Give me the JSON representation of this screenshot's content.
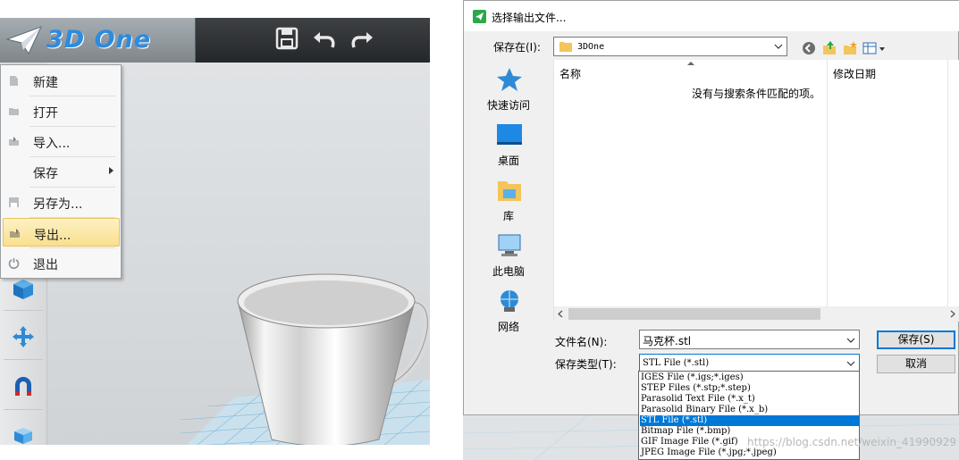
{
  "app": {
    "logo_text": "3D One",
    "toolbar": {
      "save_icon": "save-icon",
      "undo_icon": "undo-icon",
      "redo_icon": "redo-icon"
    },
    "file_menu": {
      "items": [
        {
          "label": "新建",
          "icon": "new-file-icon",
          "has_submenu": false,
          "highlighted": false
        },
        {
          "label": "打开",
          "icon": "open-folder-icon",
          "has_submenu": false,
          "highlighted": false
        },
        {
          "label": "导入...",
          "icon": "import-icon",
          "has_submenu": false,
          "highlighted": false
        },
        {
          "label": "保存",
          "icon": "",
          "has_submenu": true,
          "highlighted": false
        },
        {
          "label": "另存为...",
          "icon": "save-as-icon",
          "has_submenu": false,
          "highlighted": false
        },
        {
          "label": "导出...",
          "icon": "export-icon",
          "has_submenu": false,
          "highlighted": true
        },
        {
          "label": "退出",
          "icon": "power-icon",
          "has_submenu": false,
          "highlighted": false
        }
      ]
    },
    "left_tools": [
      "cube-tool-icon",
      "move-tool-icon",
      "magnet-tool-icon",
      "box-tool-icon"
    ]
  },
  "dialog": {
    "title": "选择输出文件...",
    "save_in_label": "保存在(I):",
    "save_in_value": "3DOne",
    "places": [
      {
        "label": "快速访问",
        "icon": "quick-access-icon"
      },
      {
        "label": "桌面",
        "icon": "desktop-icon"
      },
      {
        "label": "库",
        "icon": "library-icon"
      },
      {
        "label": "此电脑",
        "icon": "this-pc-icon"
      },
      {
        "label": "网络",
        "icon": "network-icon"
      }
    ],
    "columns": [
      "名称",
      "修改日期"
    ],
    "empty_message": "没有与搜索条件匹配的项。",
    "filename_label": "文件名(N):",
    "filename_value": "马克杯.stl",
    "filetype_label": "保存类型(T):",
    "filetype_value": "STL File (*.stl)",
    "save_button": "保存(S)",
    "cancel_button": "取消",
    "filetype_options": [
      "IGES File (*.igs;*.iges)",
      "STEP Files (*.stp;*.step)",
      "Parasolid Text File (*.x_t)",
      "Parasolid Binary File (*.x_b)",
      "STL File (*.stl)",
      "Bitmap File (*.bmp)",
      "GIF Image File (*.gif)",
      "JPEG Image File (*.jpg;*.jpeg)"
    ],
    "selected_option_index": 4
  },
  "watermark": "https://blog.csdn.net/weixin_41990929",
  "colors": {
    "accent": "#0078d7",
    "menu_highlight": "#f9df8e",
    "logo_blue": "#2d8be0"
  }
}
